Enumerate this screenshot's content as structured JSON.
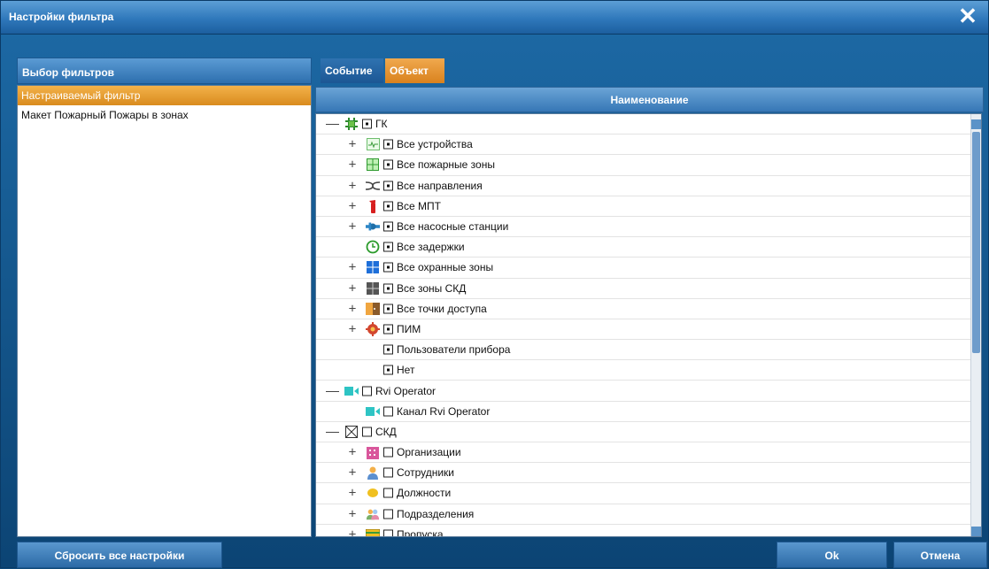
{
  "window": {
    "title": "Настройки фильтра"
  },
  "left_panel": {
    "header": "Выбор фильтров",
    "items": [
      {
        "label": "Настраиваемый фильтр",
        "selected": true
      },
      {
        "label": "Макет Пожарный Пожары в зонах",
        "selected": false
      }
    ]
  },
  "tabs": [
    {
      "label": "Событие",
      "active": false
    },
    {
      "label": "Объект",
      "active": true
    }
  ],
  "grid": {
    "column_header": "Наименование",
    "rows": [
      {
        "label": "ГК",
        "expander": "—",
        "icon": "gk-icon",
        "checked": true
      },
      {
        "label": "Все устройства",
        "expander": "+",
        "icon": "devices-icon",
        "checked": true
      },
      {
        "label": "Все пожарные зоны",
        "expander": "+",
        "icon": "fire-zones-icon",
        "checked": true
      },
      {
        "label": "Все направления",
        "expander": "+",
        "icon": "directions-icon",
        "checked": true
      },
      {
        "label": "Все МПТ",
        "expander": "+",
        "icon": "mpt-icon",
        "checked": true
      },
      {
        "label": "Все насосные станции",
        "expander": "+",
        "icon": "pump-station-icon",
        "checked": true
      },
      {
        "label": "Все задержки",
        "expander": "",
        "icon": "clock-icon",
        "checked": true
      },
      {
        "label": "Все охранные зоны",
        "expander": "+",
        "icon": "guard-zones-icon",
        "checked": true
      },
      {
        "label": "Все зоны СКД",
        "expander": "+",
        "icon": "skd-zones-icon",
        "checked": true
      },
      {
        "label": "Все точки доступа",
        "expander": "+",
        "icon": "door-icon",
        "checked": true
      },
      {
        "label": "ПИМ",
        "expander": "+",
        "icon": "gear-icon",
        "checked": true
      },
      {
        "label": "Пользователи прибора",
        "expander": "",
        "icon": "",
        "checked": true
      },
      {
        "label": "Нет",
        "expander": "",
        "icon": "",
        "checked": true
      },
      {
        "label": "Rvi Operator",
        "expander": "—",
        "icon": "camera-icon",
        "checked": false
      },
      {
        "label": "Канал Rvi Operator",
        "expander": "",
        "icon": "camera-icon",
        "checked": false
      },
      {
        "label": "СКД",
        "expander": "—",
        "icon": "skd-icon",
        "checked": false
      },
      {
        "label": "Организации",
        "expander": "+",
        "icon": "building-icon",
        "checked": false
      },
      {
        "label": "Сотрудники",
        "expander": "+",
        "icon": "employee-icon",
        "checked": false
      },
      {
        "label": "Должности",
        "expander": "+",
        "icon": "position-icon",
        "checked": false
      },
      {
        "label": "Подразделения",
        "expander": "+",
        "icon": "department-icon",
        "checked": false
      },
      {
        "label": "Пропуска",
        "expander": "+",
        "icon": "pass-icon",
        "checked": false
      }
    ]
  },
  "buttons": {
    "reset": "Сбросить все настройки",
    "ok": "Ok",
    "cancel": "Отмена"
  }
}
